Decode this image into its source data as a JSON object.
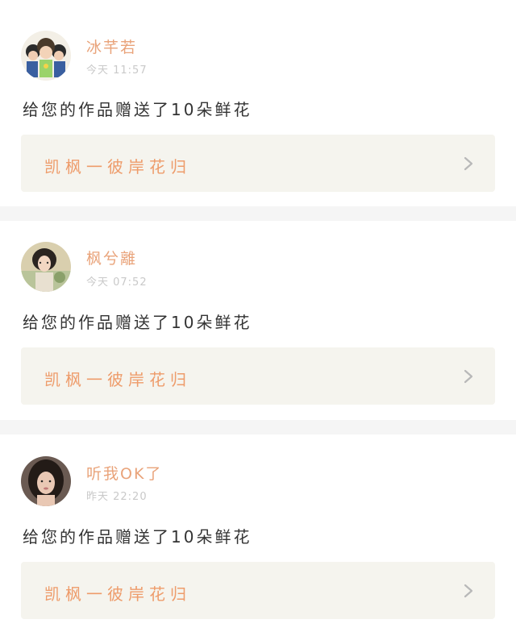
{
  "notifications": [
    {
      "username": "冰芊若",
      "time": "今天 11:57",
      "message": "给您的作品赠送了10朵鲜花",
      "work_title": "凯枫一彼岸花归",
      "avatar": "avatar-icon"
    },
    {
      "username": "枫兮離",
      "time": "今天 07:52",
      "message": "给您的作品赠送了10朵鲜花",
      "work_title": "凯枫一彼岸花归",
      "avatar": "avatar-icon"
    },
    {
      "username": "听我OK了",
      "time": "昨天 22:20",
      "message": "给您的作品赠送了10朵鲜花",
      "work_title": "凯枫一彼岸花归",
      "avatar": "avatar-icon"
    }
  ],
  "colors": {
    "username": "#e9a37a",
    "work_title": "#ee9c6b",
    "link_bg": "#f5f4ee",
    "divider": "#f5f5f5"
  }
}
